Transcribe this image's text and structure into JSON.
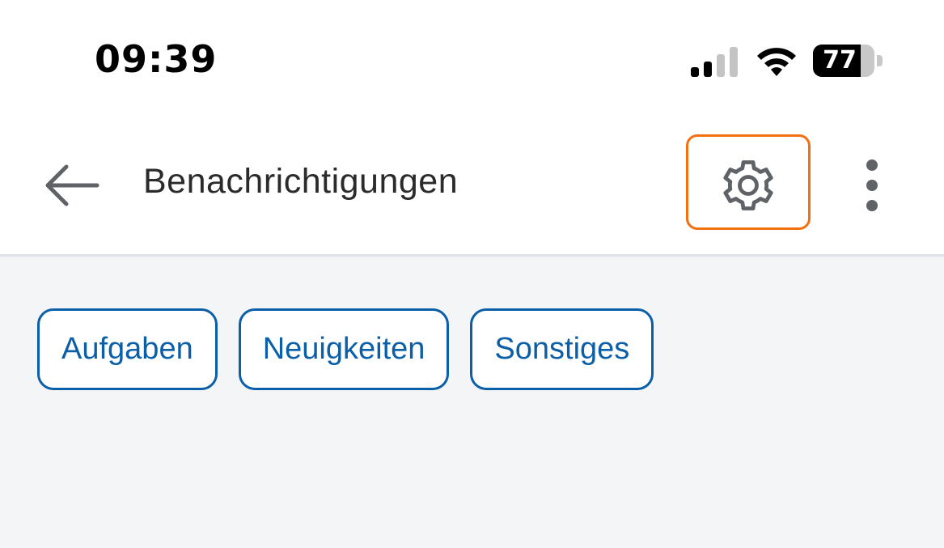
{
  "status_bar": {
    "time": "09:39",
    "battery_level": "77",
    "battery_fraction": 0.77,
    "signal_bars_active": 2,
    "signal_bars_total": 4,
    "icons": [
      "cellular-signal-icon",
      "wifi-icon",
      "battery-icon"
    ]
  },
  "app_bar": {
    "title": "Benachrichtigungen",
    "back_icon": "arrow-left-icon",
    "settings_icon": "gear-icon",
    "more_icon": "more-vertical-icon",
    "highlight_color": "#f2700f"
  },
  "filters": {
    "chips": [
      {
        "label": "Aufgaben"
      },
      {
        "label": "Neuigkeiten"
      },
      {
        "label": "Sonstiges"
      }
    ],
    "accent_color": "#0a5fa8"
  },
  "colors": {
    "content_background": "#f4f5f7",
    "app_bar_background": "#ffffff",
    "icon_gray": "#5f6368"
  }
}
